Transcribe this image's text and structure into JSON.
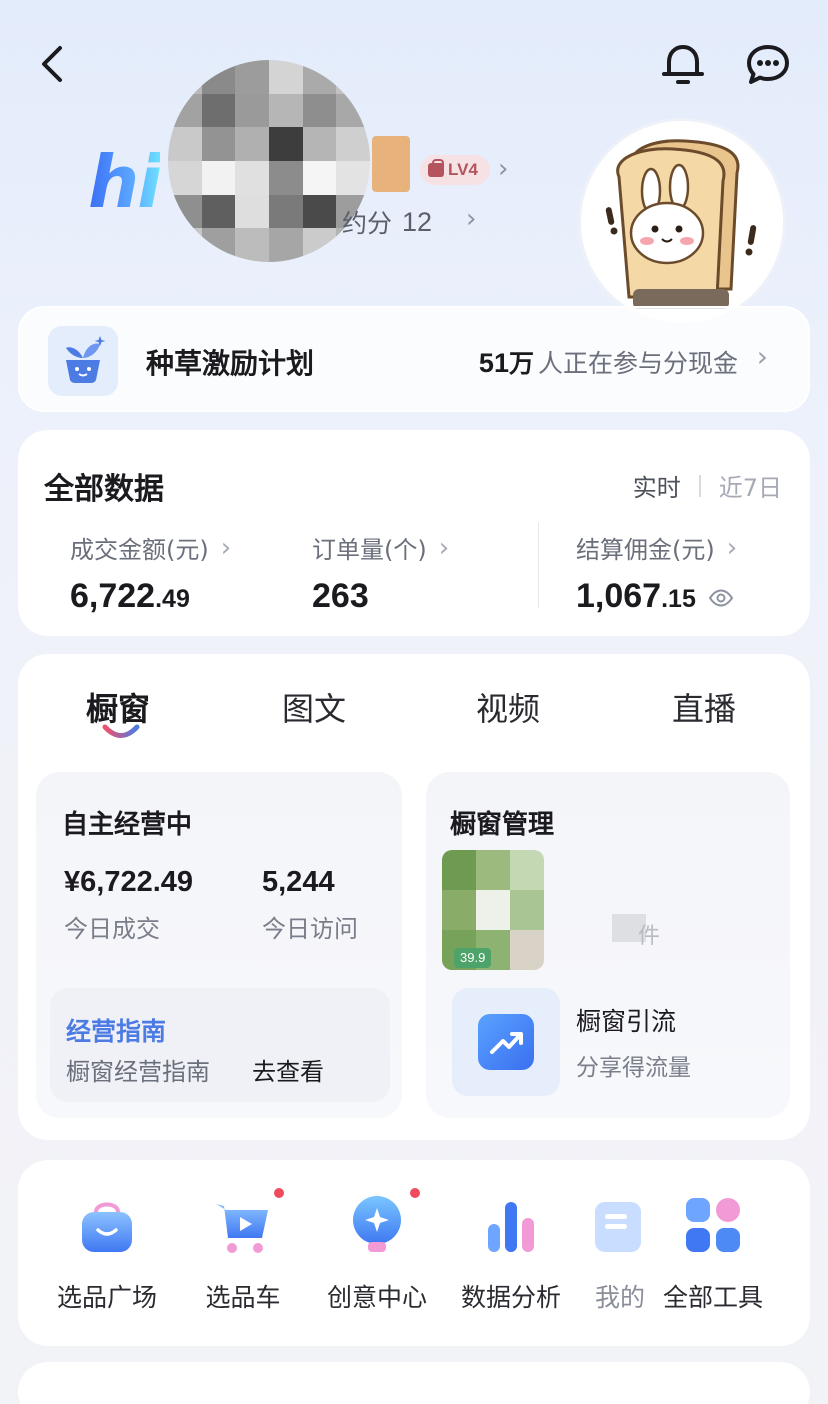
{
  "header": {
    "greeting": "hi",
    "level": "LV4",
    "score_label": "约分",
    "score_value": "12"
  },
  "campaign": {
    "title": "种草激励计划",
    "participants_num": "51",
    "participants_unit": "万",
    "participants_suffix": "人正在参与分现金"
  },
  "data_panel": {
    "title": "全部数据",
    "range_tabs": [
      "实时",
      "近7日"
    ],
    "metrics": [
      {
        "label": "成交金额(元)",
        "int": "6,722",
        "dec": ".49"
      },
      {
        "label": "订单量(个)",
        "int": "263",
        "dec": ""
      },
      {
        "label": "结算佣金(元)",
        "int": "1,067",
        "dec": ".15"
      }
    ]
  },
  "content_tabs": [
    "橱窗",
    "图文",
    "视频",
    "直播"
  ],
  "self_operating": {
    "title": "自主经营中",
    "sales_value": "¥6,722.49",
    "sales_label": "今日成交",
    "visits_value": "5,244",
    "visits_label": "今日访问",
    "guide_title": "经营指南",
    "guide_desc": "橱窗经营指南",
    "guide_link": "去查看"
  },
  "shop_management": {
    "title": "橱窗管理",
    "price_tag": "39.9",
    "count_text": "件",
    "traffic_title": "橱窗引流",
    "traffic_sub": "分享得流量"
  },
  "tools": [
    {
      "label": "选品广场",
      "icon": "shopping-bag-icon",
      "badge": false
    },
    {
      "label": "选品车",
      "icon": "cart-icon",
      "badge": true
    },
    {
      "label": "创意中心",
      "icon": "lightbulb-icon",
      "badge": true
    },
    {
      "label": "数据分析",
      "icon": "bar-chart-icon",
      "badge": false
    },
    {
      "label": "我的",
      "icon": "wallet-icon",
      "badge": false
    },
    {
      "label": "全部工具",
      "icon": "grid-apps-icon",
      "badge": false
    }
  ],
  "colors": {
    "accent_blue": "#4d7be4",
    "badge_red": "#f04a5e",
    "level_pink": "#b4545d"
  }
}
